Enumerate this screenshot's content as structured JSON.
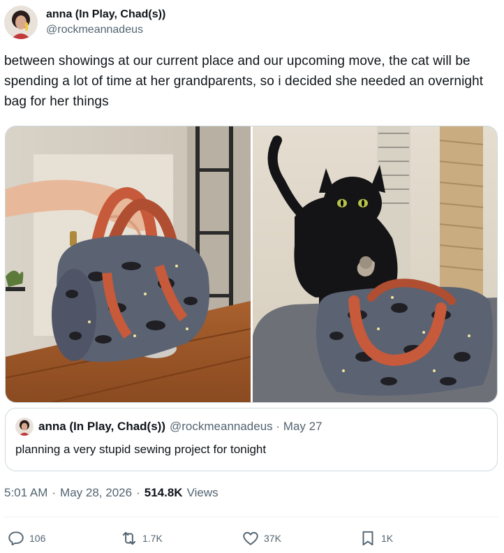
{
  "author": {
    "display_name": "anna (In Play, Chad(s))",
    "handle": "@rockmeannadeus"
  },
  "tweet": {
    "text": "between showings at our current place and our upcoming move, the cat will be spending a lot of time at her grandparents, so i decided she needed an overnight bag for her things"
  },
  "quote": {
    "display_name": "anna (In Play, Chad(s))",
    "meta": "@rockmeannadeus · May 27",
    "text": "planning a very stupid sewing project for tonight"
  },
  "timestamp": {
    "time": "5:01 AM",
    "sep1": "·",
    "date": "May 28, 2026",
    "sep2": "·",
    "views_count": "514.8K",
    "views_label": "Views"
  },
  "actions": {
    "replies": "106",
    "reposts": "1.7K",
    "likes": "37K",
    "bookmarks": "1K"
  },
  "colors": {
    "text": "#0f1419",
    "secondary": "#536471",
    "border": "#cfd9de",
    "bag_handle": "#c65a3a",
    "bag_fabric": "#5b6272"
  }
}
